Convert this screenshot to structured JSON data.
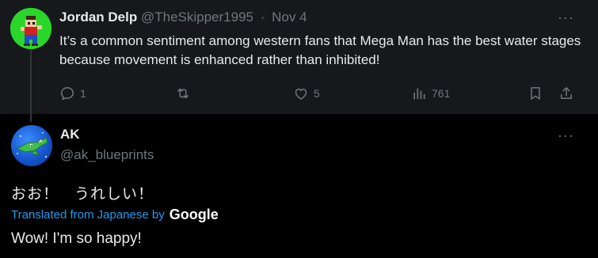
{
  "post1": {
    "author_name": "Jordan Delp",
    "author_handle": "@TheSkipper1995",
    "separator": "·",
    "date": "Nov 4",
    "text": "It’s a common sentiment among western fans that Mega Man has the best water stages because movement is enhanced rather than inhibited!",
    "more_label": "···",
    "actions": {
      "reply_count": "1",
      "repost_count": "",
      "like_count": "5",
      "view_count": "761"
    }
  },
  "post2": {
    "author_name": "AK",
    "author_handle": "@ak_blueprints",
    "more_label": "···",
    "original_text": "おお！　うれしい！",
    "translated_from": "Translated from Japanese by",
    "translator_brand": "Google",
    "translation": "Wow! I'm so happy!"
  },
  "colors": {
    "background": "#000000",
    "highlight_background": "#16181c",
    "primary_text": "#e7e9ea",
    "secondary_text": "#71767b",
    "accent": "#1d9bf0"
  },
  "icons": [
    "reply-icon",
    "repost-icon",
    "like-icon",
    "views-icon",
    "bookmark-icon",
    "share-icon",
    "more-icon"
  ]
}
